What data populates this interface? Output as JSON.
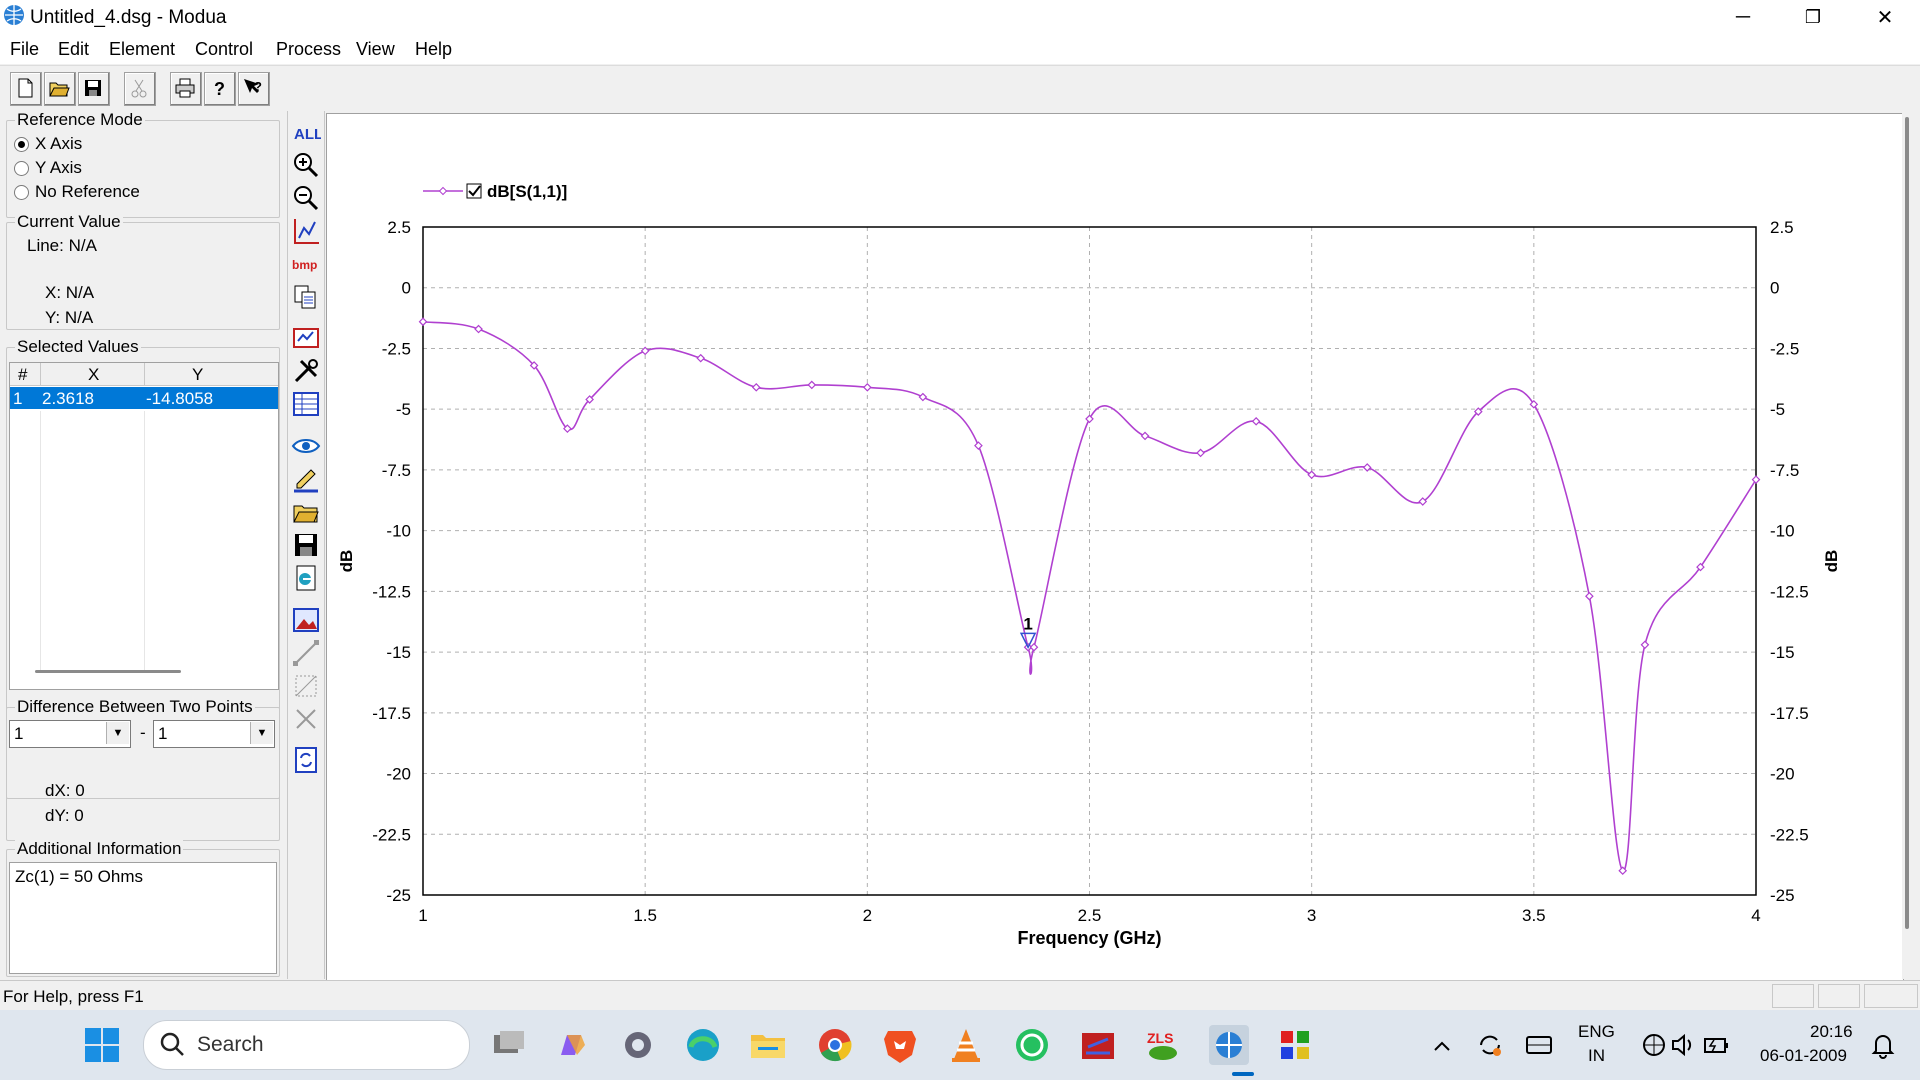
{
  "window": {
    "title": "Untitled_4.dsg - Modua",
    "minimize": "─",
    "restore": "❐",
    "close": "✕"
  },
  "menu": [
    "File",
    "Edit",
    "Element",
    "Control",
    "Process",
    "View",
    "Help"
  ],
  "left_panel": {
    "reference_mode": {
      "legend": "Reference Mode",
      "options": [
        "X Axis",
        "Y Axis",
        "No Reference"
      ],
      "selected": "X Axis"
    },
    "current_value": {
      "legend": "Current Value",
      "line": "Line: N/A",
      "x": "X: N/A",
      "y": "Y: N/A"
    },
    "selected_values": {
      "legend": "Selected Values",
      "columns": [
        "#",
        "X",
        "Y"
      ],
      "rows": [
        {
          "n": "1",
          "x": "2.3618",
          "y": "-14.8058"
        }
      ]
    },
    "difference": {
      "legend": "Difference Between Two Points",
      "point_a": "1",
      "separator": "-",
      "point_b": "1",
      "dx": "dX: 0",
      "dy": "dY: 0"
    },
    "additional_info": {
      "legend": "Additional Information",
      "text": "Zc(1) = 50 Ohms"
    }
  },
  "vertical_toolbar": [
    "all-icon",
    "zoom-in-icon",
    "zoom-out-icon",
    "chart-axis-icon",
    "bmp-icon",
    "copy-icon",
    "marker-icon",
    "tools-icon",
    "table-icon",
    "eye-icon",
    "pen-icon",
    "open-folder-icon",
    "save-icon",
    "export-icon",
    "image-icon",
    "line-tool-icon",
    "grid-tool-icon",
    "delete-icon",
    "refresh-icon"
  ],
  "toolbar": [
    "new-file-icon",
    "open-folder-icon",
    "save-icon",
    "cut-icon",
    "print-icon",
    "help-icon",
    "context-help-icon"
  ],
  "colors": {
    "series": "#b040d0",
    "grid": "#b0b0b0",
    "selection": "#0078d7",
    "marker": "#3050d0"
  },
  "chart_data": {
    "type": "line",
    "xlabel": "Frequency (GHz)",
    "ylabel": "dB",
    "ylabel_right": "dB",
    "xlim": [
      1,
      4
    ],
    "ylim": [
      -25,
      2.5
    ],
    "xticks": [
      "1",
      "1.5",
      "2",
      "2.5",
      "3",
      "3.5",
      "4"
    ],
    "yticks": [
      "2.5",
      "0",
      "-2.5",
      "-5",
      "-7.5",
      "-10",
      "-12.5",
      "-15",
      "-17.5",
      "-20",
      "-22.5",
      "-25"
    ],
    "grid": true,
    "legend_position": "top-left",
    "series": [
      {
        "name": "dB[S(1,1)]",
        "x": [
          1.0,
          1.125,
          1.25,
          1.325,
          1.375,
          1.5,
          1.625,
          1.75,
          1.875,
          2.0,
          2.125,
          2.25,
          2.3618,
          2.375,
          2.5,
          2.625,
          2.75,
          2.875,
          3.0,
          3.125,
          3.25,
          3.375,
          3.5,
          3.625,
          3.7,
          3.75,
          3.875,
          4.0
        ],
        "values": [
          -1.4,
          -1.7,
          -3.2,
          -5.8,
          -4.6,
          -2.6,
          -2.9,
          -4.1,
          -4.0,
          -4.1,
          -4.5,
          -6.5,
          -14.8,
          -14.8,
          -5.4,
          -6.1,
          -6.8,
          -5.5,
          -7.7,
          -7.4,
          -8.8,
          -5.1,
          -4.8,
          -12.7,
          -24.0,
          -14.7,
          -11.5,
          -7.9
        ]
      }
    ],
    "markers": [
      {
        "label": "1",
        "x": 2.3618,
        "y": -14.8058
      }
    ]
  },
  "status_bar": {
    "text": "For Help, press F1"
  },
  "taskbar": {
    "search": "Search",
    "language": "ENG",
    "region": "IN",
    "time": "20:16",
    "date": "06-01-2009"
  }
}
